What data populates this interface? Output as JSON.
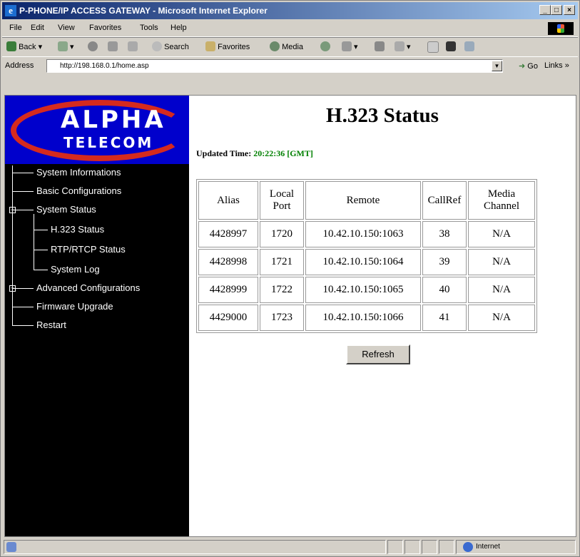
{
  "window": {
    "title": "P-PHONE/IP ACCESS GATEWAY - Microsoft Internet Explorer",
    "minimize": "_",
    "maximize": "□",
    "close": "×"
  },
  "menu": [
    "File",
    "Edit",
    "View",
    "Favorites",
    "Tools",
    "Help"
  ],
  "toolbar": {
    "back": "Back",
    "search": "Search",
    "favorites": "Favorites",
    "media": "Media"
  },
  "address": {
    "label": "Address",
    "url": "http://198.168.0.1/home.asp",
    "go": "Go",
    "links": "Links »"
  },
  "logo": {
    "line1": "ALPHA",
    "line2": "TELECOM"
  },
  "nav": [
    "System Informations",
    "Basic Configurations",
    "System Status",
    "H.323 Status",
    "RTP/RTCP Status",
    "System Log",
    "Advanced Configurations",
    "Firmware Upgrade",
    "Restart"
  ],
  "main": {
    "title": "H.323 Status",
    "updated_label": "Updated Time:",
    "updated_value": "20:22:36 [GMT]",
    "headers": [
      "Alias",
      "Local Port",
      "Remote",
      "CallRef",
      "Media Channel"
    ],
    "rows": [
      [
        "4428997",
        "1720",
        "10.42.10.150:1063",
        "38",
        "N/A"
      ],
      [
        "4428998",
        "1721",
        "10.42.10.150:1064",
        "39",
        "N/A"
      ],
      [
        "4428999",
        "1722",
        "10.42.10.150:1065",
        "40",
        "N/A"
      ],
      [
        "4429000",
        "1723",
        "10.42.10.150:1066",
        "41",
        "N/A"
      ]
    ],
    "refresh": "Refresh"
  },
  "status": {
    "zone": "Internet"
  }
}
